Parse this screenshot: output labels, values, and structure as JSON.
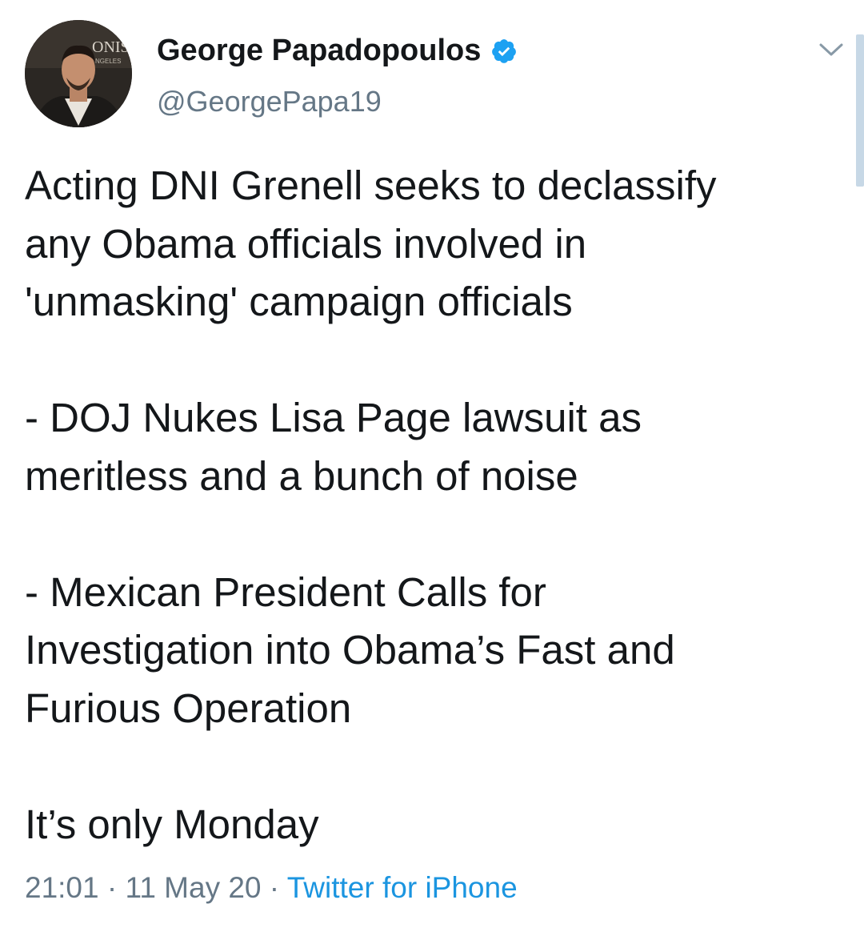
{
  "author": {
    "name": "George Papadopoulos",
    "handle": "@GeorgePapa19",
    "verified": true,
    "avatar_backdrop_text": "ONIST",
    "avatar_backdrop_subtext": "NGELES"
  },
  "icons": {
    "verified": "verified-badge-icon",
    "menu": "chevron-down-icon"
  },
  "tweet": {
    "paragraphs": [
      "Acting DNI Grenell seeks to declassify\nany Obama officials involved in\n'unmasking' campaign officials",
      "- DOJ Nukes Lisa Page lawsuit as\nmeritless and a bunch of noise",
      "- Mexican President Calls for\nInvestigation into Obama’s Fast and\nFurious Operation",
      "It’s only Monday"
    ],
    "time": "21:01",
    "date": "11 May 20",
    "separator": "·",
    "source": "Twitter for iPhone"
  },
  "colors": {
    "text": "#14171a",
    "secondary": "#657786",
    "link": "#1b95e0",
    "verified": "#1da1f2",
    "scrollbar": "#c7d8e6"
  }
}
